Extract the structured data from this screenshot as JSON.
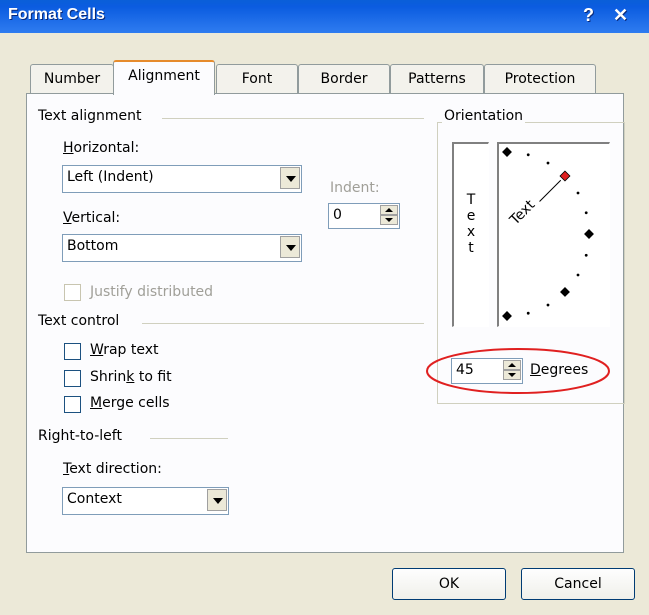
{
  "window": {
    "title": "Format Cells",
    "help_label": "?",
    "close_label": "✕"
  },
  "tabs": [
    "Number",
    "Alignment",
    "Font",
    "Border",
    "Patterns",
    "Protection"
  ],
  "active_tab": "Alignment",
  "text_alignment": {
    "group_label": "Text alignment",
    "horizontal_label": "Horizontal:",
    "horizontal_value": "Left (Indent)",
    "vertical_label": "Vertical:",
    "vertical_value": "Bottom",
    "indent_label": "Indent:",
    "indent_value": "0",
    "justify_distributed_label": "Justify distributed"
  },
  "text_control": {
    "group_label": "Text control",
    "wrap_text": "Wrap text",
    "shrink_to_fit": "Shrink to fit",
    "merge_cells": "Merge cells"
  },
  "right_to_left": {
    "group_label": "Right-to-left",
    "text_direction_label": "Text direction:",
    "text_direction_value": "Context"
  },
  "orientation": {
    "group_label": "Orientation",
    "vertical_text": "T e x t",
    "dial_text": "Text",
    "degrees_value": "45",
    "degrees_label": "Degrees",
    "highlight_color": "#e02020"
  },
  "footer": {
    "ok_label": "OK",
    "cancel_label": "Cancel"
  }
}
